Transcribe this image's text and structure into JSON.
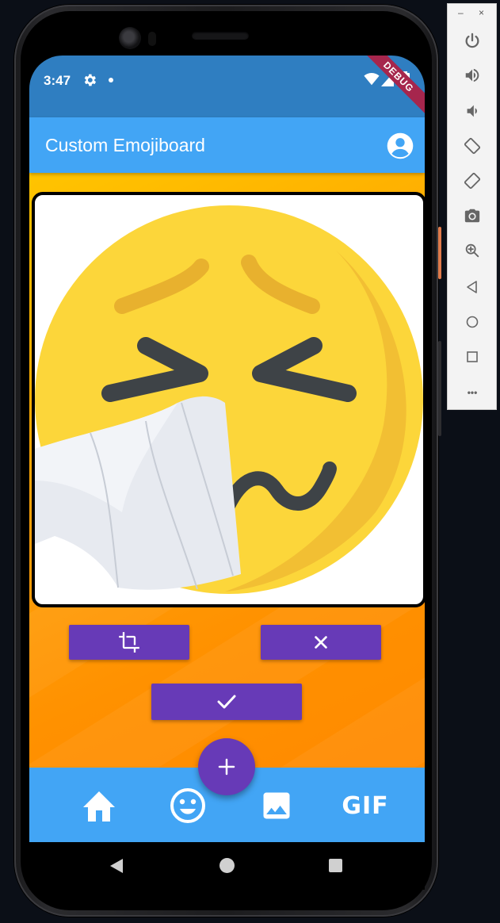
{
  "status_bar": {
    "time": "3:47",
    "debug_banner": "DEBUG"
  },
  "app_bar": {
    "title": "Custom Emojiboard"
  },
  "bottom_nav": {
    "gif_label": "GIF"
  },
  "colors": {
    "status_bar": "#2f7ec1",
    "app_bar": "#42a5f5",
    "accent_purple": "#673ab7",
    "debug_ribbon": "#a6264d",
    "background_gradient_start": "#ffc400",
    "background_gradient_end": "#ff8a00"
  },
  "icons": {
    "status": [
      "gear-icon",
      "dot-icon",
      "wifi-icon",
      "signal-icon",
      "battery-icon"
    ],
    "app_bar": "account-circle-icon",
    "actions": [
      "crop-icon",
      "close-icon",
      "check-icon"
    ],
    "fab": "plus-icon",
    "nav": [
      "home-icon",
      "emoji-icon",
      "image-icon",
      "gif-icon"
    ],
    "system_nav": [
      "back-icon",
      "home-circle-icon",
      "recents-icon"
    ],
    "emulator": [
      "power-icon",
      "volume-up-icon",
      "volume-down-icon",
      "rotate-left-icon",
      "rotate-right-icon",
      "camera-icon",
      "zoom-icon",
      "back-icon",
      "home-icon",
      "overview-icon",
      "more-icon"
    ]
  },
  "emulator_toolbar": {
    "minimize": "–",
    "close": "×",
    "more": "•••"
  }
}
